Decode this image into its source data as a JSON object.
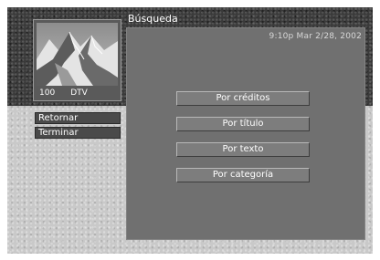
{
  "header": {
    "title": "Búsqueda",
    "clock": "9:10p Mar 2/28, 2002"
  },
  "preview": {
    "channel": "100",
    "network": "DTV"
  },
  "side_menu": [
    {
      "label": "Retornar"
    },
    {
      "label": "Terminar"
    }
  ],
  "search_options": [
    {
      "label": "Por créditos"
    },
    {
      "label": "Por título"
    },
    {
      "label": "Por texto"
    },
    {
      "label": "Por categoría"
    }
  ]
}
